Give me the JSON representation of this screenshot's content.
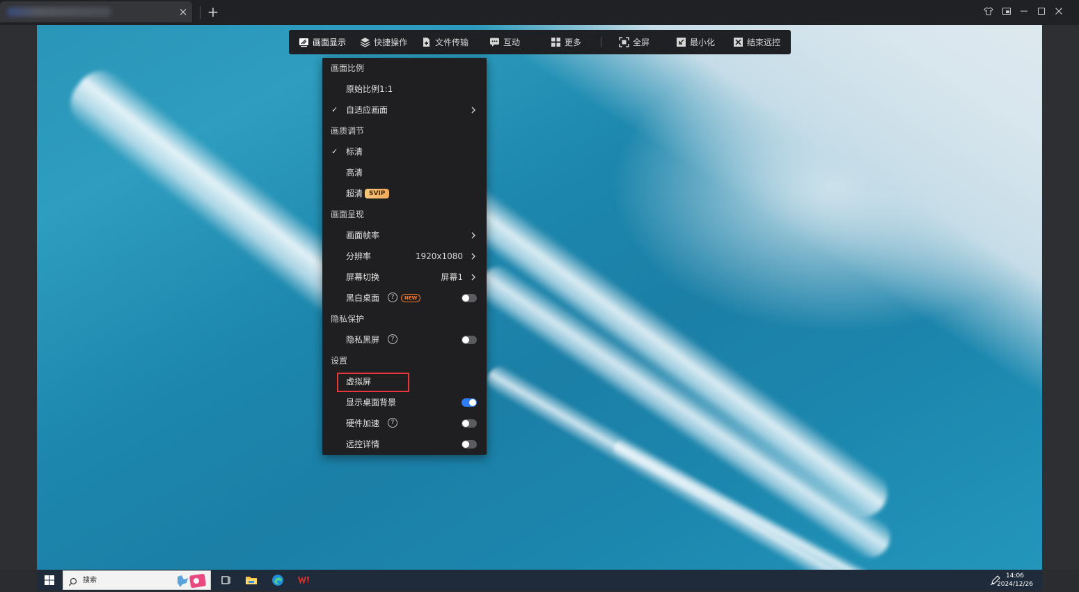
{
  "window": {
    "tab_close": "×",
    "tab_add": "+",
    "controls": {
      "pin": "⇧",
      "restore_alt": "⧉",
      "minimize": "—",
      "maximize": "☐",
      "close": "✕"
    }
  },
  "toolbar": {
    "items": [
      {
        "label": "画面显示",
        "icon": "display-icon",
        "active": true
      },
      {
        "label": "快捷操作",
        "icon": "layers-icon"
      },
      {
        "label": "文件传输",
        "icon": "file-transfer-icon"
      },
      {
        "label": "互动",
        "icon": "chat-icon"
      },
      {
        "label": "更多",
        "icon": "grid-icon"
      },
      {
        "label": "全屏",
        "icon": "fullscreen-icon"
      },
      {
        "label": "最小化",
        "icon": "minimize-icon"
      },
      {
        "label": "结束远控",
        "icon": "end-remote-icon"
      }
    ]
  },
  "menu": {
    "sections": {
      "ratio": "画面比例",
      "quality": "画质调节",
      "render": "画面呈现",
      "privacy": "隐私保护",
      "settings": "设置"
    },
    "items": {
      "original_ratio": "原始比例1:1",
      "fit_screen": "自适应画面",
      "sd": "标清",
      "hd": "高清",
      "uhd": "超清",
      "uhd_badge": "SVIP",
      "frame_rate": "画面帧率",
      "resolution": "分辨率",
      "resolution_value": "1920x1080",
      "screen_switch": "屏幕切换",
      "screen_value": "屏幕1",
      "bw_desktop": "黑白桌面",
      "bw_badge": "NEW",
      "privacy_black": "隐私黑屏",
      "virtual_screen": "虚拟屏",
      "show_wallpaper": "显示桌面背景",
      "hw_accel": "硬件加速",
      "remote_details": "远控详情",
      "check": "✓",
      "help": "?"
    },
    "toggles": {
      "bw_desktop": false,
      "privacy_black": false,
      "show_wallpaper": true,
      "hw_accel": false,
      "remote_details": false
    },
    "accent_color": "#2f7df6",
    "highlight_color": "#e8373c"
  },
  "taskbar": {
    "search_placeholder": "搜索",
    "time": "14:06",
    "date": "2024/12/26"
  }
}
